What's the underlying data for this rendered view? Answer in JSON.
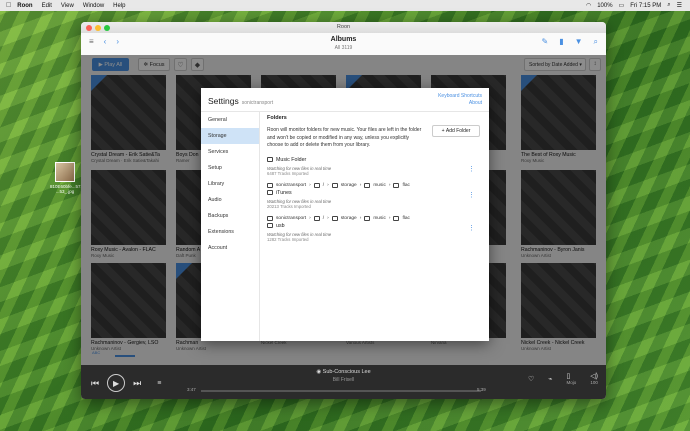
{
  "menubar": {
    "app": "Roon",
    "items": [
      "Edit",
      "View",
      "Window",
      "Help"
    ],
    "battery": "100%",
    "clock": "Fri 7:15 PM"
  },
  "desktop_icon": {
    "label": "810E60bfe...571 ...53_.jpg"
  },
  "window": {
    "title": "Roon",
    "header_title": "Albums",
    "header_sub": "All 3119",
    "play_all": "Play All",
    "focus": "Focus",
    "sort": "Sorted by Date Added"
  },
  "albums": [
    {
      "title": "Crystal Dream - Erik Satie&Ta",
      "artist": "Crystal Dream · Erik Satie&Takahi"
    },
    {
      "title": "Boys Don",
      "artist": "Ramer"
    },
    {
      "title": "",
      "artist": ""
    },
    {
      "title": "",
      "artist": ""
    },
    {
      "title": "",
      "artist": ""
    },
    {
      "title": "- Of",
      "artist": ""
    },
    {
      "title": "The Best of Roxy Music",
      "artist": "Roxy Music"
    },
    {
      "title": "Roxy Music - Avalon - FLAC",
      "artist": "Roxy Music"
    },
    {
      "title": "Random A",
      "artist": "Daft Punk"
    },
    {
      "title": "",
      "artist": ""
    },
    {
      "title": "",
      "artist": ""
    },
    {
      "title": "",
      "artist": ""
    },
    {
      "title": "h his 2",
      "artist": ""
    },
    {
      "title": "Rachmaninov - Byron Janis",
      "artist": "Unknown Artist"
    },
    {
      "title": "Rachmaninov - Gergiev, LSO",
      "artist": "Unknown Artist"
    },
    {
      "title": "Rachman",
      "artist": "Unknown Artist"
    },
    {
      "title": "",
      "artist": "Nickel Creek"
    },
    {
      "title": "",
      "artist": "Various Artists"
    },
    {
      "title": "",
      "artist": "Nirvana"
    },
    {
      "title": "",
      "artist": ""
    },
    {
      "title": "Nickel Creek - Nickel Creek",
      "artist": "Unknown Artist"
    }
  ],
  "settings": {
    "title": "Settings",
    "device": "sonictransport",
    "links": [
      "Keyboard Shortcuts",
      "About"
    ],
    "nav": [
      "General",
      "Storage",
      "Services",
      "Setup",
      "Library",
      "Audio",
      "Backups",
      "Extensions",
      "Account"
    ],
    "active": "Storage",
    "heading": "Folders",
    "description": "Roon will monitor folders for new music. Your files are left in the folder and won't be copied or modified in any way, unless you explicitly choose to add or delete them from your library.",
    "add_folder": "Add Folder",
    "folders": [
      {
        "path": [],
        "name": "Music Folder",
        "status": "Watching for new files in real time",
        "count": "6487 Tracks Imported"
      },
      {
        "path": [
          "sonictransport",
          "/",
          "storage",
          "music",
          "flac"
        ],
        "name": "iTunes",
        "status": "Watching for new files in real time",
        "count": "20213 Tracks Imported"
      },
      {
        "path": [
          "sonictransport",
          "/",
          "storage",
          "music",
          "flac"
        ],
        "name": "usb",
        "status": "Watching for new files in real time",
        "count": "1282 Tracks Imported"
      }
    ]
  },
  "player": {
    "track": "Sub-Conscious Lee",
    "artist": "Bill Frisell",
    "elapsed": "3:47",
    "total": "5:39",
    "zone": "Mojo",
    "volume": "100"
  },
  "colors": {
    "accent": "#4a90e2",
    "player_bg": "#2b2b2b"
  }
}
